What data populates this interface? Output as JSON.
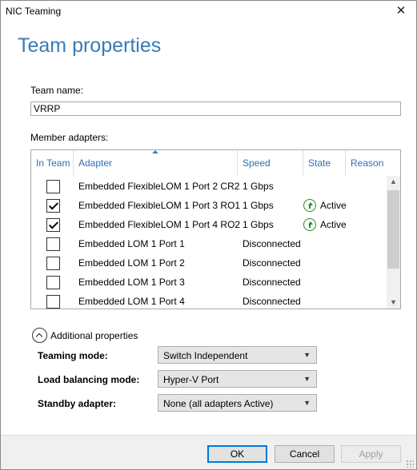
{
  "window": {
    "title": "NIC Teaming",
    "close_symbol": "✕"
  },
  "heading": "Team properties",
  "team_name": {
    "label": "Team name:",
    "value": "VRRP"
  },
  "member_adapters": {
    "label": "Member adapters:",
    "columns": [
      "In Team",
      "Adapter",
      "Speed",
      "State",
      "Reason"
    ],
    "sorted_column": "Adapter",
    "rows": [
      {
        "in_team": false,
        "adapter": "Embedded FlexibleLOM 1 Port 2 CR2",
        "speed": "1 Gbps",
        "state": "",
        "reason": ""
      },
      {
        "in_team": true,
        "adapter": "Embedded FlexibleLOM 1 Port 3 RO1",
        "speed": "1 Gbps",
        "state": "Active",
        "reason": ""
      },
      {
        "in_team": true,
        "adapter": "Embedded FlexibleLOM 1 Port 4 RO2",
        "speed": "1 Gbps",
        "state": "Active",
        "reason": ""
      },
      {
        "in_team": false,
        "adapter": "Embedded LOM 1 Port 1",
        "speed": "Disconnected",
        "state": "",
        "reason": ""
      },
      {
        "in_team": false,
        "adapter": "Embedded LOM 1 Port 2",
        "speed": "Disconnected",
        "state": "",
        "reason": ""
      },
      {
        "in_team": false,
        "adapter": "Embedded LOM 1 Port 3",
        "speed": "Disconnected",
        "state": "",
        "reason": ""
      },
      {
        "in_team": false,
        "adapter": "Embedded LOM 1 Port 4",
        "speed": "Disconnected",
        "state": "",
        "reason": ""
      }
    ],
    "state_icon": "up-arrow-circle-icon",
    "state_color": "#2b8a2b"
  },
  "additional_properties": {
    "label": "Additional properties",
    "teaming_mode": {
      "label": "Teaming mode:",
      "value": "Switch Independent"
    },
    "load_balancing_mode": {
      "label": "Load balancing mode:",
      "value": "Hyper-V Port"
    },
    "standby_adapter": {
      "label": "Standby adapter:",
      "value": "None (all adapters Active)"
    }
  },
  "buttons": {
    "ok": "OK",
    "cancel": "Cancel",
    "apply": "Apply"
  },
  "colors": {
    "heading": "#3a7ab5",
    "column_header": "#2e6fb3",
    "default_button_border": "#0078d7"
  }
}
